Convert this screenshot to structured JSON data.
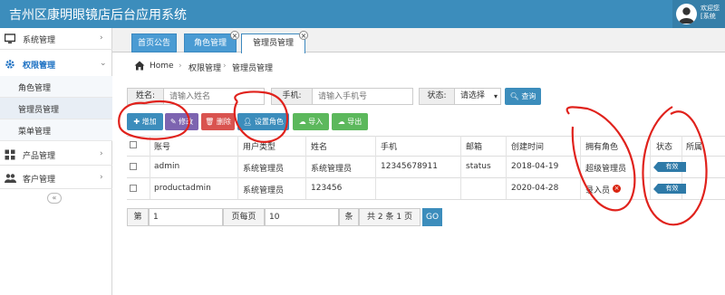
{
  "header": {
    "app_title": "吉州区康明眼镜店后台应用系统",
    "greeting_line1": "欢迎您",
    "greeting_line2": "[系统"
  },
  "sidebar": {
    "menus": [
      {
        "label": "系统管理",
        "icon": "monitor-icon"
      },
      {
        "label": "权限管理",
        "icon": "gear-icon"
      },
      {
        "label": "产品管理",
        "icon": "grid-icon"
      },
      {
        "label": "客户管理",
        "icon": "users-icon"
      }
    ],
    "submenus": [
      "角色管理",
      "管理员管理",
      "菜单管理"
    ],
    "collapse_label": "«"
  },
  "tabs": [
    {
      "label": "首页公告",
      "closable": false
    },
    {
      "label": "角色管理",
      "closable": true
    },
    {
      "label": "管理员管理",
      "closable": true,
      "active": true
    }
  ],
  "breadcrumb": {
    "home": "Home",
    "sep": "›",
    "level1": "权限管理",
    "level2": "管理员管理"
  },
  "search": {
    "name_label": "姓名:",
    "name_placeholder": "请输入姓名",
    "phone_label": "手机:",
    "phone_placeholder": "请输入手机号",
    "status_label": "状态:",
    "status_value": "请选择",
    "query_label": "查询"
  },
  "actions": {
    "add": "增加",
    "edit": "修改",
    "delete": "删除",
    "set_role": "设置角色",
    "import": "导入",
    "export": "导出"
  },
  "table": {
    "headers": [
      "账号",
      "用户类型",
      "姓名",
      "手机",
      "邮箱",
      "创建时间",
      "拥有角色",
      "状态",
      "所属"
    ],
    "rows": [
      {
        "account": "admin",
        "type": "系统管理员",
        "name": "系统管理员",
        "phone": "12345678911",
        "email": "status",
        "created": "2018-04-19",
        "role": "超级管理员",
        "status": "有效"
      },
      {
        "account": "productadmin",
        "type": "系统管理员",
        "name": "123456",
        "phone": "",
        "email": "",
        "created": "2020-04-28",
        "role": "录入员",
        "status": "有效"
      }
    ]
  },
  "pager": {
    "page_label": "第",
    "page_value": "1",
    "per_page_label": "页每页",
    "per_page_value": "10",
    "unit_label": "条",
    "summary": "共 2 条 1 页",
    "go_label": "GO"
  },
  "colors": {
    "header_blue": "#3c8dbc",
    "annotation_red": "#e0221c",
    "badge": "#2e7aa8"
  }
}
